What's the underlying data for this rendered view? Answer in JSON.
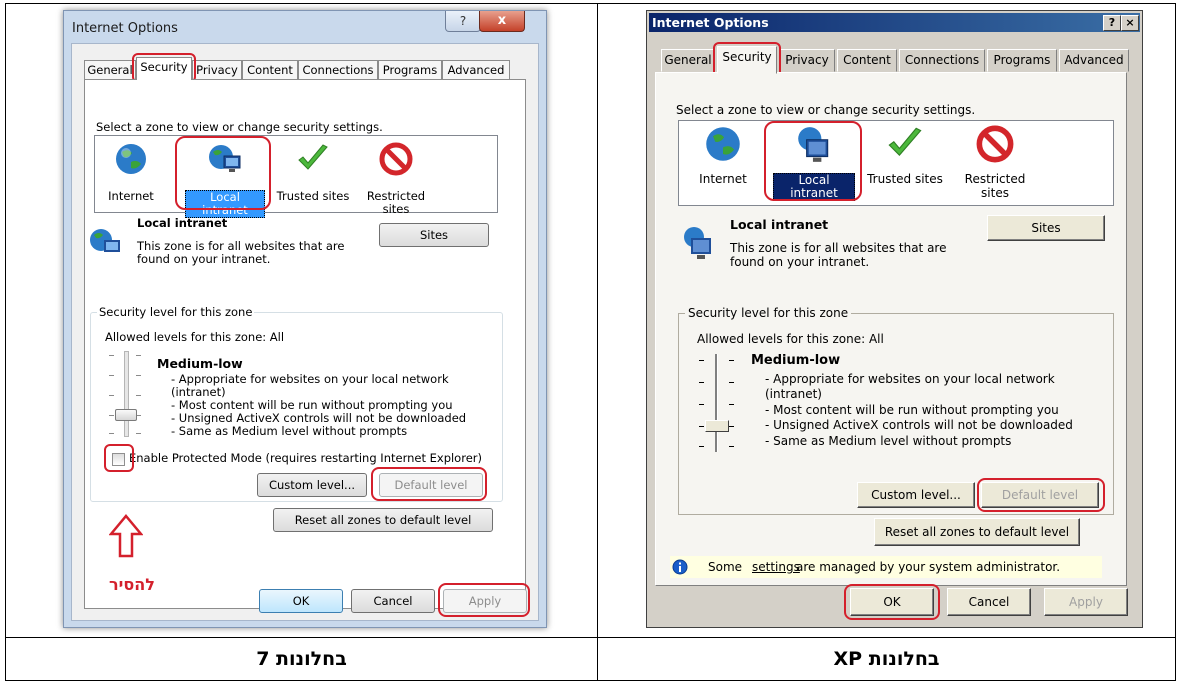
{
  "win7": {
    "title": "Internet Options",
    "help_label": "?",
    "close_label": "x",
    "tabs": [
      "General",
      "Security",
      "Privacy",
      "Content",
      "Connections",
      "Programs",
      "Advanced"
    ],
    "instruction": "Select a zone to view or change security settings.",
    "zones": [
      "Internet",
      "Local intranet",
      "Trusted sites",
      "Restricted",
      "sites"
    ],
    "zone_title": "Local intranet",
    "zone_desc": [
      "This zone is for all websites that are",
      "found on your intranet."
    ],
    "sites_label": "Sites",
    "group_title": "Security level for this zone",
    "allowed": "Allowed levels for this zone: All",
    "level_name": "Medium-low",
    "level_lines": [
      "- Appropriate for websites on your local network",
      "(intranet)",
      "- Most content will be run without prompting you",
      "- Unsigned ActiveX controls will not be downloaded",
      "- Same as Medium level without prompts"
    ],
    "protected_mode_label": "Enable Protected Mode (requires restarting Internet Explorer)",
    "custom_level_label": "Custom level...",
    "default_level_label": "Default level",
    "reset_label": "Reset all zones to default level",
    "remove_label": "להסיר",
    "ok_label": "OK",
    "cancel_label": "Cancel",
    "apply_label": "Apply"
  },
  "xp": {
    "title": "Internet Options",
    "help_label": "?",
    "close_label": "×",
    "tabs": [
      "General",
      "Security",
      "Privacy",
      "Content",
      "Connections",
      "Programs",
      "Advanced"
    ],
    "instruction": "Select a zone to view or change security settings.",
    "zones": [
      "Internet",
      "Local intranet",
      "Trusted sites",
      "Restricted",
      "sites"
    ],
    "zone_title": "Local intranet",
    "zone_desc": [
      "This zone is for all websites that are",
      "found on your intranet."
    ],
    "sites_label": "Sites",
    "group_title": "Security level for this zone",
    "allowed": "Allowed levels for this zone: All",
    "level_name": "Medium-low",
    "level_lines": [
      "- Appropriate for websites on your local network",
      "(intranet)",
      "- Most content will be run without prompting you",
      "- Unsigned ActiveX controls will not be downloaded",
      "- Same as Medium level without prompts"
    ],
    "custom_level_label": "Custom level...",
    "default_level_label": "Default level",
    "reset_label": "Reset all zones to default level",
    "info_pre": "Some ",
    "info_link": "settings",
    "info_post": " are managed by your system administrator.",
    "ok_label": "OK",
    "cancel_label": "Cancel",
    "apply_label": "Apply"
  },
  "captions": {
    "left": "בחלונות 7",
    "right": "בחלונות XP"
  },
  "colors": {
    "highlight": "#d4202c",
    "xp_title": "#0a246a",
    "info_bar": "#ffffe1"
  }
}
